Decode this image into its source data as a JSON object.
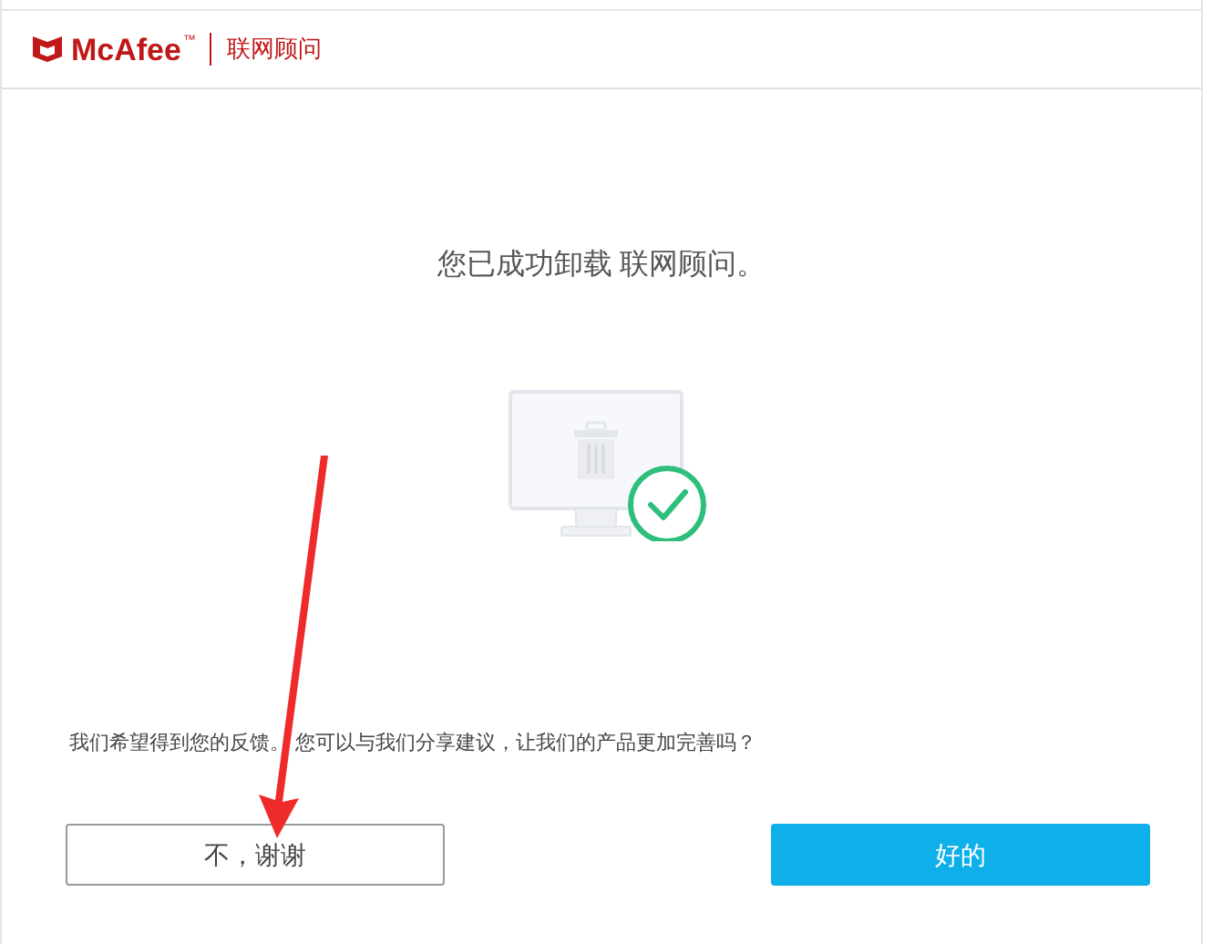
{
  "header": {
    "brand": "McAfee",
    "trademark": "™",
    "product": "联网顾问"
  },
  "message": "您已成功卸载 联网顾问。",
  "feedback_prompt": "我们希望得到您的反馈。 您可以与我们分享建议，让我们的产品更加完善吗？",
  "buttons": [
    {
      "label": "不，谢谢",
      "kind": "secondary"
    },
    {
      "label": "好的",
      "kind": "primary"
    }
  ]
}
